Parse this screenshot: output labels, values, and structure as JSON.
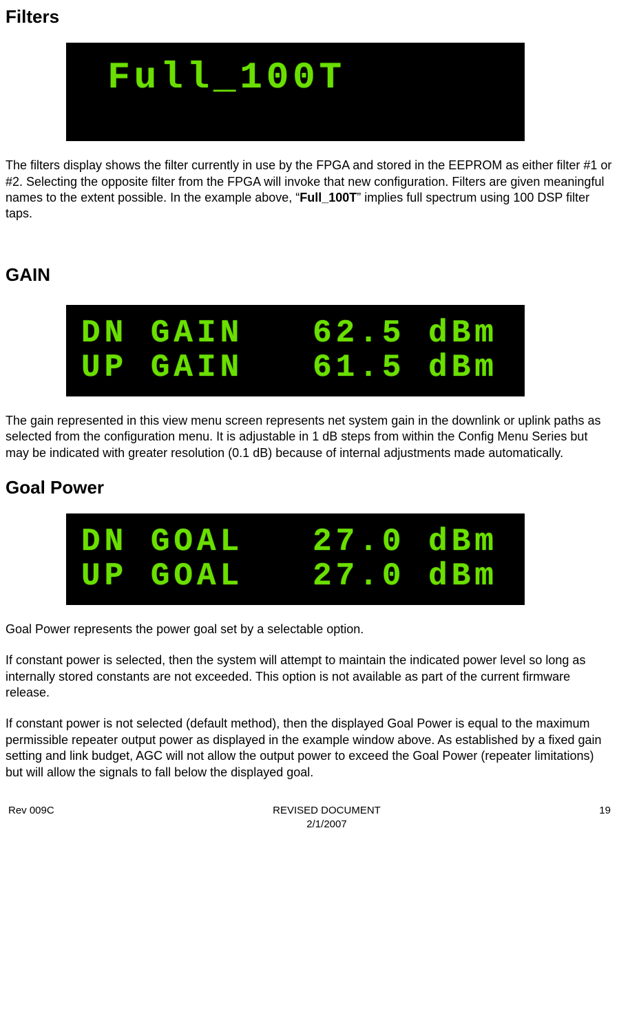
{
  "sections": {
    "filters": {
      "heading": "Filters",
      "lcd_line1": " Full_100T",
      "para_pre": "The filters display shows the filter currently in use by the FPGA and stored in the EEPROM as either filter #1 or #2.  Selecting the opposite filter from the FPGA will invoke that new configuration.  Filters are given meaningful names to the extent possible.  In the example above, “",
      "para_bold": "Full_100T",
      "para_post": "” implies full spectrum using 100 DSP filter taps."
    },
    "gain": {
      "heading": "GAIN",
      "lcd_line1_label": "DN GAIN",
      "lcd_line1_value": "62.5 dBm",
      "lcd_line2_label": "UP GAIN",
      "lcd_line2_value": "61.5 dBm",
      "para": "The gain represented in this view menu screen represents net system gain in the downlink or uplink paths as selected from the configuration menu.  It is adjustable in 1 dB steps from within the Config Menu Series but may be indicated with greater resolution (0.1 dB) because of internal adjustments made automatically."
    },
    "goal": {
      "heading": "Goal Power",
      "lcd_line1_label": "DN GOAL",
      "lcd_line1_value": "27.0 dBm",
      "lcd_line2_label": "UP GOAL",
      "lcd_line2_value": "27.0 dBm",
      "para1": "Goal Power represents the power goal set by a selectable option.",
      "para2": "If constant power is selected, then the system will attempt to maintain the indicated power level so long as internally stored constants are not exceeded. This option is not available as part of the current firmware release.",
      "para3": "If constant power is not selected (default method), then the displayed Goal Power is equal to the maximum permissible repeater output power as displayed in the example window above.  As established by a fixed gain setting and link budget, AGC will not allow the output power to exceed the Goal Power (repeater limitations) but will allow the signals to fall below the displayed goal."
    }
  },
  "footer": {
    "left": "Rev 009C",
    "center1": "REVISED DOCUMENT",
    "center2": "2/1/2007",
    "right": "19"
  }
}
